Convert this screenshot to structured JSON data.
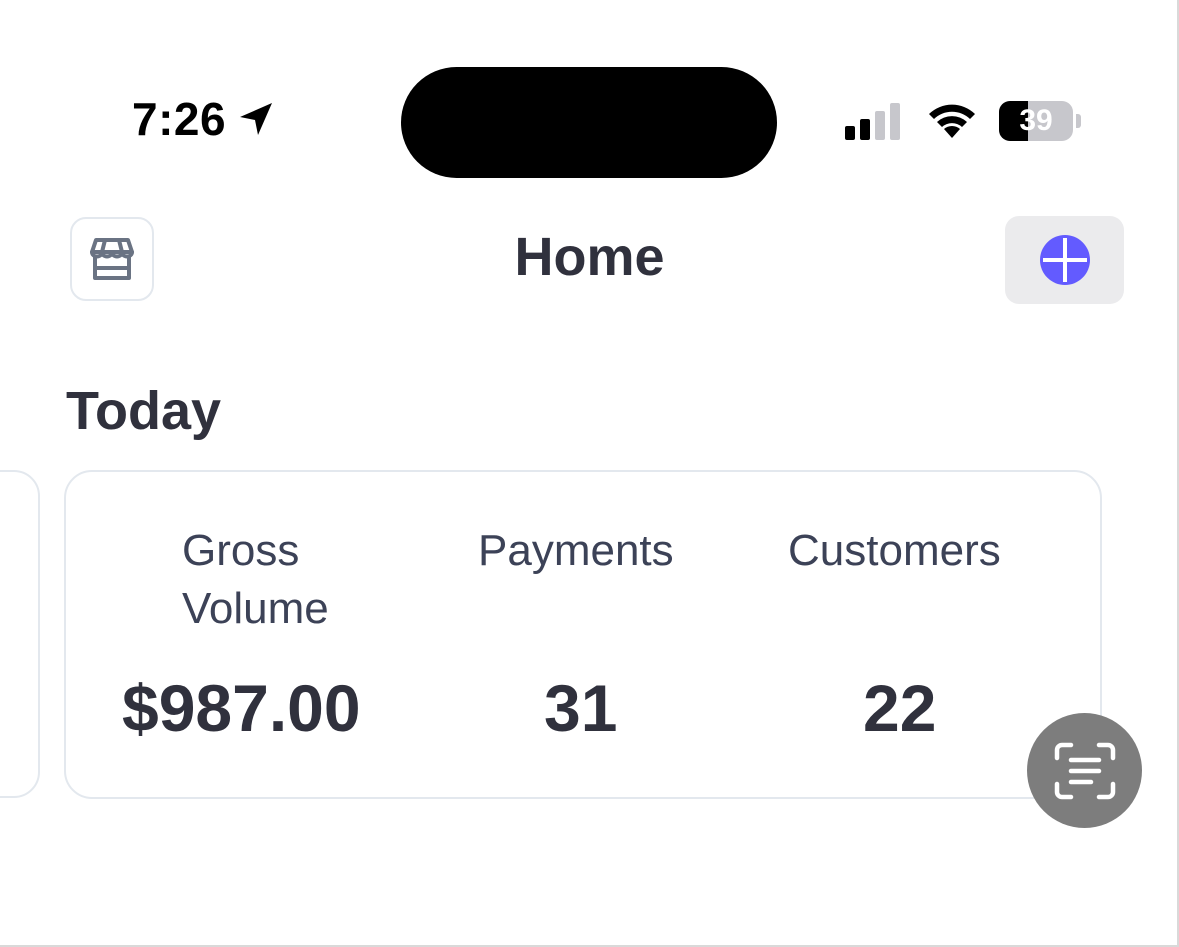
{
  "status_bar": {
    "time": "7:26",
    "battery_level": "39",
    "battery_fraction": 0.39,
    "icons": [
      "location-arrow-icon",
      "cellular-signal-icon",
      "wifi-icon",
      "battery-icon"
    ]
  },
  "header": {
    "title": "Home",
    "left_icon": "storefront-icon",
    "right_icon": "plus-circle-icon",
    "accent_color": "#635bff"
  },
  "today": {
    "section_title": "Today",
    "stats": [
      {
        "label": "Gross Volume",
        "value": "$987.00"
      },
      {
        "label": "Payments",
        "value": "31"
      },
      {
        "label": "Customers",
        "value": "22"
      }
    ]
  },
  "floating_button": {
    "icon": "scan-text-icon"
  }
}
